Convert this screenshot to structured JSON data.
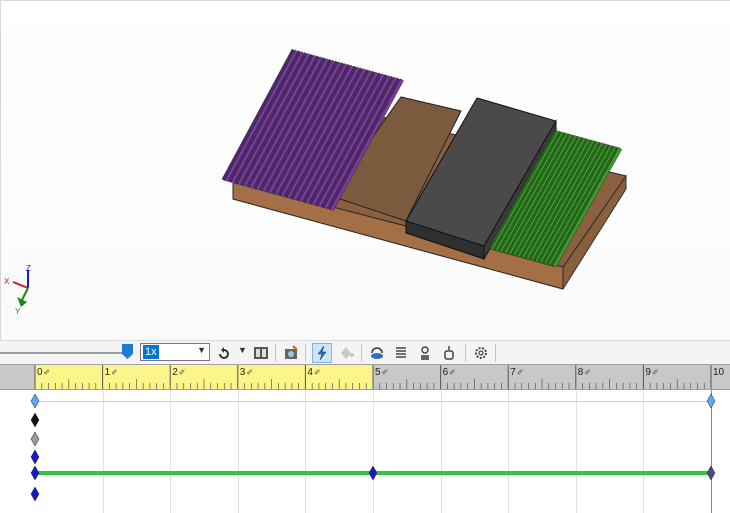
{
  "viewport": {
    "triad": {
      "x_label": "X",
      "y_label": "Y",
      "z_label": "Z"
    }
  },
  "toolbar": {
    "playback_speed": {
      "value": "1x",
      "options_visible": [
        "1x"
      ]
    },
    "icons": [
      "playback-mode-icon",
      "save-animation-icon",
      "animation-wizard-icon",
      "autokey-icon",
      "add-update-key-icon",
      "motor-icon",
      "spring-icon",
      "contact-icon",
      "gravity-icon",
      "motion-study-properties-icon"
    ]
  },
  "timeline": {
    "ruler_labels": [
      "0 sec",
      "1 sec",
      "2 sec",
      "3 sec",
      "4 sec",
      "5 sec",
      "6 sec",
      "7 sec",
      "8 sec",
      "9 sec",
      "10 sec"
    ],
    "ruler_numbers": [
      "0",
      "1",
      "2",
      "3",
      "4",
      "5",
      "6",
      "7",
      "8",
      "9",
      "10"
    ],
    "highlighted_range_end": 5,
    "max_time": 10,
    "colors": {
      "ruler_highlight": "#fbf58a",
      "active_bar": "#36c43a",
      "key_blue": "#1a1acc",
      "key_light": "#5aa9f0"
    }
  }
}
